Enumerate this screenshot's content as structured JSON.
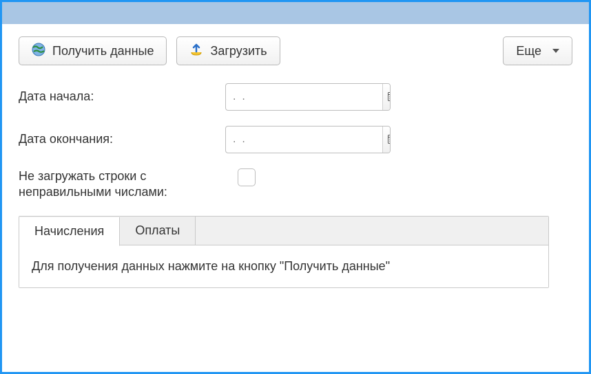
{
  "toolbar": {
    "get_data_label": "Получить данные",
    "upload_label": "Загрузить",
    "more_label": "Еще"
  },
  "form": {
    "start_date_label": "Дата начала:",
    "end_date_label": "Дата окончания:",
    "skip_bad_rows_label": "Не загружать строки с неправильными числами:",
    "start_date_value": ".  .",
    "end_date_value": ".  .",
    "skip_bad_rows_checked": false
  },
  "tabs": {
    "charges_label": "Начисления",
    "payments_label": "Оплаты",
    "active": "charges",
    "charges_hint": "Для получения данных нажмите на кнопку \"Получить данные\""
  }
}
